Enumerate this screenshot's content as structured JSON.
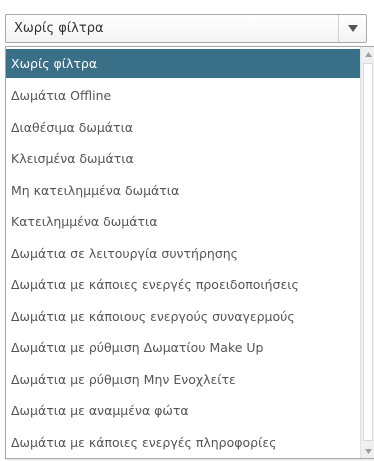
{
  "filter_select": {
    "selected_value": "Χωρίς φίλτρα",
    "arrow_icon": "triangle-down-icon"
  },
  "dropdown": {
    "options": [
      {
        "label": "Χωρίς φίλτρα",
        "selected": true
      },
      {
        "label": "Δωμάτια Offline",
        "selected": false
      },
      {
        "label": "Διαθέσιμα δωμάτια",
        "selected": false
      },
      {
        "label": "Κλεισμένα δωμάτια",
        "selected": false
      },
      {
        "label": "Μη κατειλημμένα δωμάτια",
        "selected": false
      },
      {
        "label": "Κατειλημμένα δωμάτια",
        "selected": false
      },
      {
        "label": "Δωμάτια σε λειτουργία συντήρησης",
        "selected": false
      },
      {
        "label": "Δωμάτια με κάποιες ενεργές προειδοποιήσεις",
        "selected": false
      },
      {
        "label": "Δωμάτια με κάποιους ενεργούς συναγερμούς",
        "selected": false
      },
      {
        "label": "Δωμάτια με ρύθμιση Δωματίου Make Up",
        "selected": false
      },
      {
        "label": "Δωμάτια με ρύθμιση Μην Ενοχλείτε",
        "selected": false
      },
      {
        "label": "Δωμάτια με αναμμένα φώτα",
        "selected": false
      },
      {
        "label": "Δωμάτια με κάποιες ενεργές πληροφορίες",
        "selected": false
      }
    ]
  },
  "colors": {
    "selected_background": "#3a6f88",
    "selected_text": "#ffffff",
    "option_text": "#555555",
    "border": "#a9a9a9"
  },
  "scrollbar": {
    "up_icon": "scroll-up-arrow-icon",
    "down_icon": "scroll-down-arrow-icon"
  }
}
